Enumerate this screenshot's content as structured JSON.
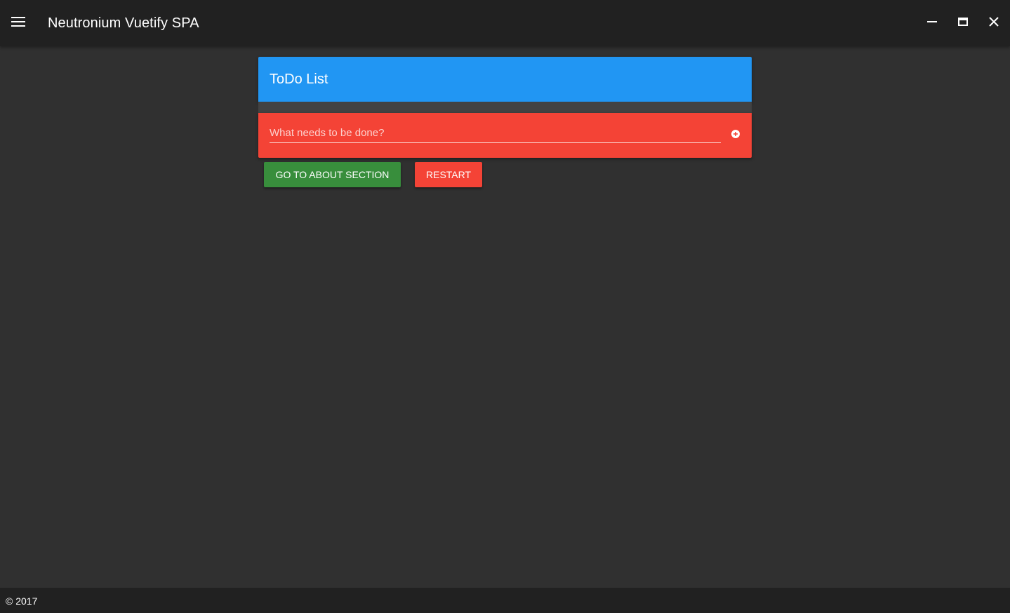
{
  "window": {
    "title": "Neutronium Vuetify SPA"
  },
  "toolbar": {
    "menu_icon": "menu-icon",
    "window_controls": {
      "minimize_icon": "minimize-icon",
      "maximize_icon": "maximize-icon",
      "close_icon": "close-icon"
    }
  },
  "todo_card": {
    "title": "ToDo List",
    "input": {
      "value": "",
      "placeholder": "What needs to be done?"
    },
    "add_icon": "add-circle-icon"
  },
  "actions": {
    "about_label": "GO TO ABOUT SECTION",
    "restart_label": "RESTART"
  },
  "footer": {
    "text": "© 2017"
  },
  "colors": {
    "background": "#303030",
    "toolbar": "#212121",
    "primary": "#2196f3",
    "accent_red": "#f44336",
    "success_green": "#388e3c"
  }
}
